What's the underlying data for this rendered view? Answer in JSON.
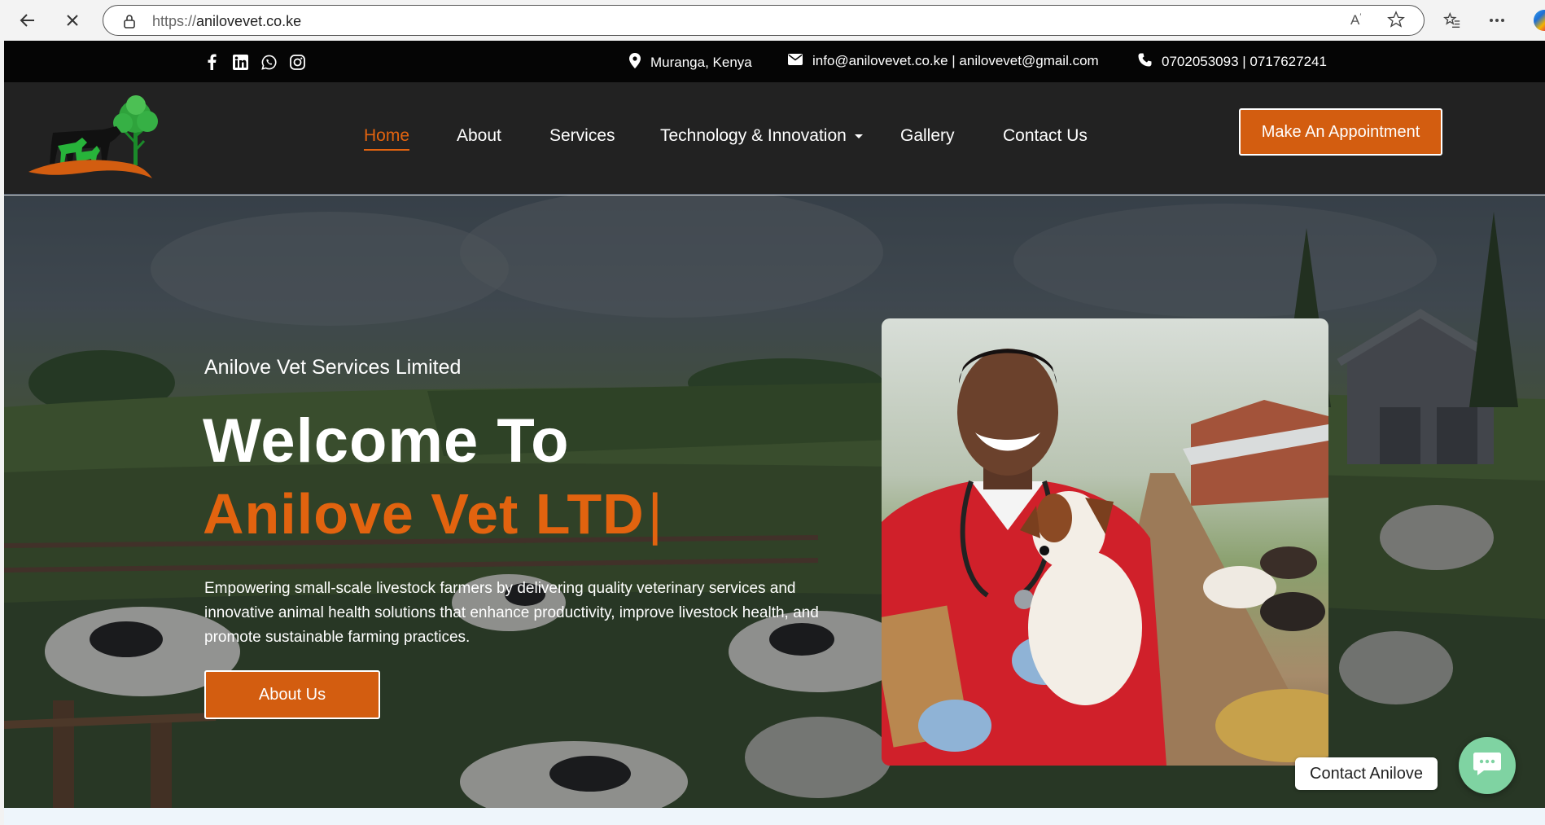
{
  "browser": {
    "url_scheme": "https://",
    "url_host": "anilovevet.co.ke",
    "reader_label": "A"
  },
  "topbar": {
    "social_icons": [
      "facebook-icon",
      "linkedin-icon",
      "whatsapp-icon",
      "instagram-icon"
    ],
    "location": "Muranga, Kenya",
    "email": "info@anilovevet.co.ke | anilovevet@gmail.com",
    "phone": "0702053093 | 0717627241"
  },
  "nav": {
    "items": [
      {
        "label": "Home",
        "active": true
      },
      {
        "label": "About"
      },
      {
        "label": "Services"
      },
      {
        "label": "Technology & Innovation",
        "has_dropdown": true
      },
      {
        "label": "Gallery"
      },
      {
        "label": "Contact Us"
      }
    ],
    "cta": "Make An Appointment"
  },
  "hero": {
    "subtitle": "Anilove Vet Services Limited",
    "heading_line1": "Welcome To",
    "heading_line2": "Anilove Vet LTD",
    "typing_cursor": "|",
    "description": "Empowering small-scale livestock farmers by delivering quality veterinary services and innovative animal health solutions that enhance productivity, improve livestock health, and promote sustainable farming practices.",
    "button": "About Us"
  },
  "chat": {
    "label": "Contact Anilove"
  },
  "colors": {
    "accent": "#e2630f",
    "button": "#d35d10",
    "topbar": "#050505",
    "header": "#222222",
    "chat": "#7fd3a2"
  }
}
